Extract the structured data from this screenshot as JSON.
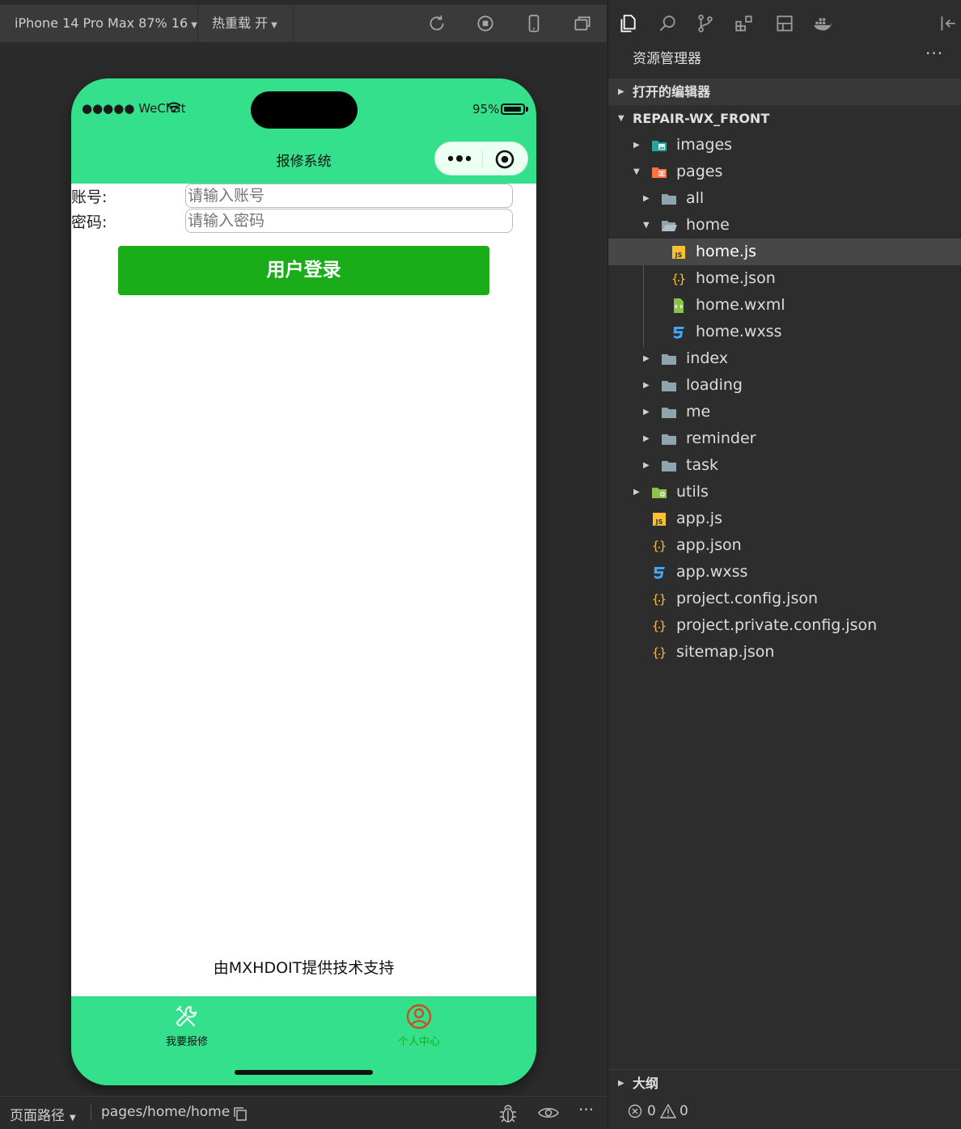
{
  "toolbar": {
    "device": "iPhone 14 Pro Max 87% 16",
    "hot_reload": "热重载 开"
  },
  "phone": {
    "status": {
      "carrier": "●●●●● WeChat",
      "battery": "95%",
      "battery_level": 0.95
    },
    "nav_title": "报修系统",
    "form": {
      "account_label": "账号:",
      "account_placeholder": "请输入账号",
      "password_label": "密码:",
      "password_placeholder": "请输入密码",
      "login_button": "用户登录"
    },
    "footer": "由MXHDOIT提供技术支持",
    "tabs": [
      {
        "label": "我要报修",
        "icon": "tools-icon",
        "color": "#111111"
      },
      {
        "label": "个人中心",
        "icon": "person-circle-icon",
        "color": "#1aad19"
      }
    ],
    "colors": {
      "nav_bg": "#34e08c",
      "button_bg": "#1aad19"
    }
  },
  "sim_bottom": {
    "route_label": "页面路径",
    "route_value": "pages/home/home"
  },
  "explorer": {
    "title": "资源管理器",
    "open_editors": "打开的编辑器",
    "project": "REPAIR-WX_FRONT",
    "tree": [
      {
        "name": "images",
        "type": "folder-images",
        "level": 1,
        "expanded": false
      },
      {
        "name": "pages",
        "type": "folder-pages",
        "level": 1,
        "expanded": true
      },
      {
        "name": "all",
        "type": "folder",
        "level": 2,
        "expanded": false
      },
      {
        "name": "home",
        "type": "folder-open",
        "level": 2,
        "expanded": true
      },
      {
        "name": "home.js",
        "type": "js",
        "level": 3,
        "selected": true
      },
      {
        "name": "home.json",
        "type": "json",
        "level": 3
      },
      {
        "name": "home.wxml",
        "type": "wxml",
        "level": 3
      },
      {
        "name": "home.wxss",
        "type": "css",
        "level": 3
      },
      {
        "name": "index",
        "type": "folder",
        "level": 2,
        "expanded": false
      },
      {
        "name": "loading",
        "type": "folder",
        "level": 2,
        "expanded": false
      },
      {
        "name": "me",
        "type": "folder",
        "level": 2,
        "expanded": false
      },
      {
        "name": "reminder",
        "type": "folder",
        "level": 2,
        "expanded": false
      },
      {
        "name": "task",
        "type": "folder",
        "level": 2,
        "expanded": false
      },
      {
        "name": "utils",
        "type": "folder-utils",
        "level": 1,
        "expanded": false
      },
      {
        "name": "app.js",
        "type": "js",
        "level": 1
      },
      {
        "name": "app.json",
        "type": "json",
        "level": 1
      },
      {
        "name": "app.wxss",
        "type": "css",
        "level": 1
      },
      {
        "name": "project.config.json",
        "type": "json",
        "level": 1
      },
      {
        "name": "project.private.config.json",
        "type": "json",
        "level": 1
      },
      {
        "name": "sitemap.json",
        "type": "json",
        "level": 1
      }
    ],
    "outline": "大纲",
    "errors": "0",
    "warnings": "0"
  }
}
